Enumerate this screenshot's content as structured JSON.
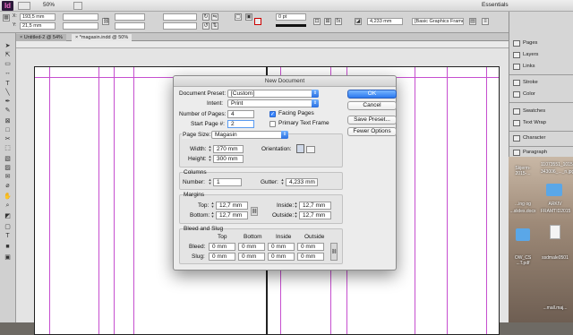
{
  "app": {
    "logo": "Id",
    "zoom": "50%",
    "workspace": "Essentials"
  },
  "control": {
    "x": "193,5 mm",
    "y": "21,5 mm",
    "stroke_pt": "0 pt",
    "measure": "4,233 mm",
    "style": "[Basic Graphics Frame]+"
  },
  "doc_tabs": [
    {
      "label": "Untitled-2 @ 54%",
      "close": "×"
    },
    {
      "label": "*magasin.indd @ 50%",
      "close": "×"
    }
  ],
  "panels": [
    {
      "label": "Pages",
      "icon": "pages-icon"
    },
    {
      "label": "Layers",
      "icon": "layers-icon"
    },
    {
      "label": "Links",
      "icon": "links-icon"
    },
    {
      "label": "Stroke",
      "icon": "stroke-icon"
    },
    {
      "label": "Color",
      "icon": "color-icon"
    },
    {
      "label": "Swatches",
      "icon": "swatches-icon"
    },
    {
      "label": "Text Wrap",
      "icon": "text-wrap-icon"
    },
    {
      "label": "Character",
      "icon": "character-icon"
    },
    {
      "label": "Paragraph",
      "icon": "paragraph-icon"
    }
  ],
  "desktop": {
    "files": [
      "Skjerm-2015-...",
      "11073551_10155",
      "343006_..._n.jpg",
      "...ing og",
      "...slides.docx",
      "ARKIV",
      "FRAMTID2015",
      "OW_CS",
      "...T.pdf",
      "ssdmale0501",
      "...mall.maj..."
    ]
  },
  "dialog": {
    "title": "New Document",
    "document_preset_label": "Document Preset:",
    "document_preset": "[Custom]",
    "intent_label": "Intent:",
    "intent": "Print",
    "num_pages_label": "Number of Pages:",
    "num_pages": "4",
    "start_page_label": "Start Page #:",
    "start_page": "2",
    "facing_pages": {
      "label": "Facing Pages",
      "checked": true
    },
    "primary_text_frame": {
      "label": "Primary Text Frame",
      "checked": false
    },
    "page_size_label": "Page Size:",
    "page_size": "Magasin",
    "width_label": "Width:",
    "width": "270 mm",
    "height_label": "Height:",
    "height": "300 mm",
    "orientation_label": "Orientation:",
    "columns": {
      "group_label": "Columns",
      "number_label": "Number:",
      "number": "1",
      "gutter_label": "Gutter:",
      "gutter": "4,233 mm"
    },
    "margins": {
      "group_label": "Margins",
      "top_label": "Top:",
      "top": "12,7 mm",
      "bottom_label": "Bottom:",
      "bottom": "12,7 mm",
      "inside_label": "Inside:",
      "inside": "12,7 mm",
      "outside_label": "Outside:",
      "outside": "12,7 mm"
    },
    "bleed_slug": {
      "group_label": "Bleed and Slug",
      "headers": [
        "Top",
        "Bottom",
        "Inside",
        "Outside"
      ],
      "bleed_label": "Bleed:",
      "bleed": [
        "0 mm",
        "0 mm",
        "0 mm",
        "0 mm"
      ],
      "slug_label": "Slug:",
      "slug": [
        "0 mm",
        "0 mm",
        "0 mm",
        "0 mm"
      ]
    },
    "buttons": {
      "ok": "OK",
      "cancel": "Cancel",
      "save_preset": "Save Preset...",
      "fewer_options": "Fewer Options"
    }
  }
}
